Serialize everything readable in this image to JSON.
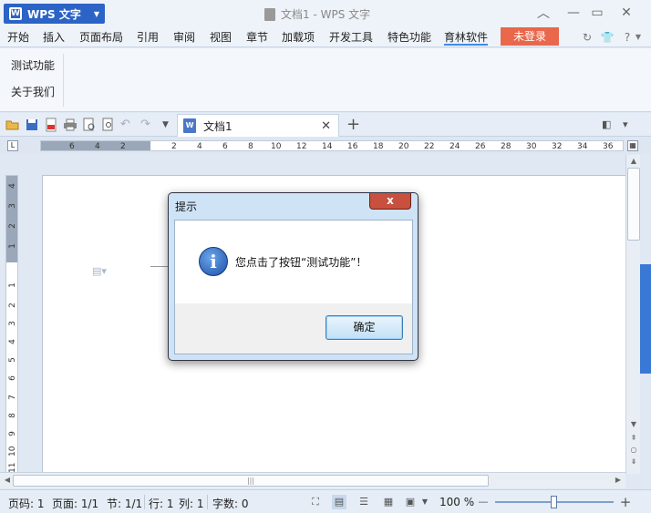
{
  "app": {
    "logo_letter": "W",
    "name": "WPS 文字",
    "window_title": "文档1 - WPS 文字"
  },
  "menu": {
    "items": [
      "开始",
      "插入",
      "页面布局",
      "引用",
      "审阅",
      "视图",
      "章节",
      "加载项",
      "开发工具",
      "特色功能",
      "育林软件"
    ],
    "active": "育林软件",
    "login": "未登录",
    "help": "?"
  },
  "ribbon": {
    "items": [
      "测试功能",
      "关于我们"
    ]
  },
  "tabs": {
    "doc_tab": "文档1",
    "doc_icon": "W"
  },
  "ruler": {
    "h_ticks": [
      "6",
      "4",
      "2",
      "2",
      "4",
      "6",
      "8",
      "10",
      "12",
      "14",
      "16",
      "18",
      "20",
      "22",
      "24",
      "26",
      "28",
      "30",
      "32",
      "34",
      "36"
    ],
    "v_ticks": [
      "4",
      "3",
      "2",
      "1",
      "1",
      "2",
      "3",
      "4",
      "5",
      "6",
      "7",
      "8",
      "9",
      "10",
      "11"
    ],
    "corner_mark": "L"
  },
  "dialog": {
    "title": "提示",
    "message": "您点击了按钮“测试功能”！",
    "ok": "确定",
    "close": "x"
  },
  "status": {
    "page_no": "页码: 1",
    "pages": "页面: 1/1",
    "section": "节: 1/1",
    "row": "行: 1",
    "col": "列: 1",
    "words": "字数: 0",
    "zoom": "100 %",
    "zoom_level": 0.5
  },
  "colors": {
    "app_button": "#2b63c6",
    "login_button": "#e9674a",
    "accent": "#3c8ce7"
  },
  "icons": [
    "open-icon",
    "save-icon",
    "pdf-icon",
    "print-icon",
    "print-preview-icon",
    "undo-icon",
    "redo-icon",
    "info-icon",
    "close-icon",
    "minimize-icon",
    "maximize-icon",
    "skin-icon",
    "refresh-icon"
  ]
}
